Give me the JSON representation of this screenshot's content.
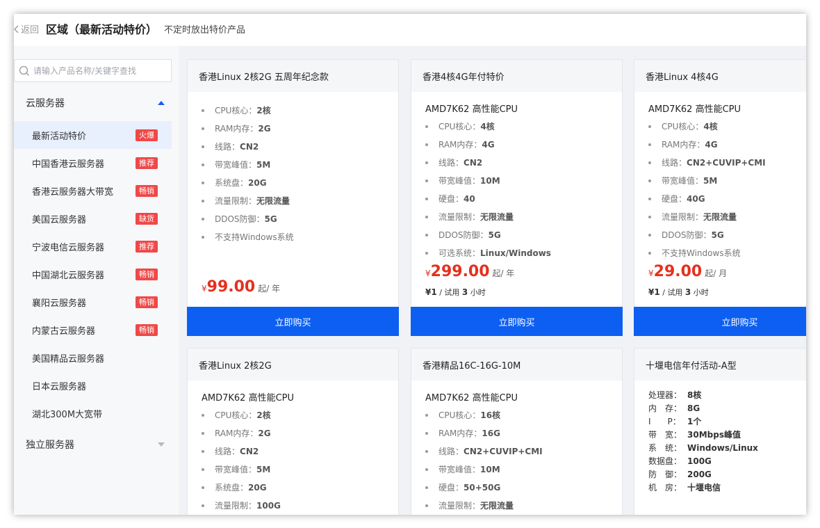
{
  "header": {
    "back_label": "返回",
    "title": "区域（最新活动特价）",
    "subtitle": "不定时放出特价产品"
  },
  "sidebar": {
    "search_placeholder": "请输入产品名称/关键字查找",
    "group_cloud": "云服务器",
    "group_dedicated": "独立服务器",
    "items": [
      {
        "label": "最新活动特价",
        "badge": "火爆"
      },
      {
        "label": "中国香港云服务器",
        "badge": "推荐"
      },
      {
        "label": "香港云服务器大带宽",
        "badge": "畅销"
      },
      {
        "label": "美国云服务器",
        "badge": "缺货"
      },
      {
        "label": "宁波电信云服务器",
        "badge": "推荐"
      },
      {
        "label": "中国湖北云服务器",
        "badge": "畅销"
      },
      {
        "label": "襄阳云服务器",
        "badge": "畅销"
      },
      {
        "label": "内蒙古云服务器",
        "badge": "畅销"
      },
      {
        "label": "美国精品云服务器",
        "badge": ""
      },
      {
        "label": "日本云服务器",
        "badge": ""
      },
      {
        "label": "湖北300M大宽带",
        "badge": ""
      }
    ]
  },
  "cards": [
    {
      "title": "香港Linux 2核2G 五周年纪念款",
      "specs": [
        {
          "k": "CPU核心：",
          "v": "2核"
        },
        {
          "k": "RAM内存：",
          "v": "2G"
        },
        {
          "k": "线路：",
          "v": "CN2"
        },
        {
          "k": "带宽峰值：",
          "v": "5M"
        },
        {
          "k": "系统盘：",
          "v": "20G"
        },
        {
          "k": "流量限制：",
          "v": "无限流量"
        },
        {
          "k": "DDOS防御：",
          "v": "5G"
        },
        {
          "k": "不支持Windows系统",
          "v": ""
        }
      ],
      "price_symbol": "¥",
      "price": "99.00",
      "price_unit": "起/ 年",
      "buy": "立即购买"
    },
    {
      "title": "香港4核4G年付特价",
      "cpu": "AMD7K62 高性能CPU",
      "specs": [
        {
          "k": "CPU核心：",
          "v": "4核"
        },
        {
          "k": "RAM内存：",
          "v": "4G"
        },
        {
          "k": "线路：",
          "v": "CN2"
        },
        {
          "k": "带宽峰值：",
          "v": "10M"
        },
        {
          "k": "硬盘：",
          "v": "40"
        },
        {
          "k": "流量限制：",
          "v": "无限流量"
        },
        {
          "k": "DDOS防御：",
          "v": "5G"
        },
        {
          "k": "可选系统：",
          "v": "Linux/Windows"
        }
      ],
      "price_symbol": "¥",
      "price": "299.00",
      "price_unit": "起/ 年",
      "trial_amt": "¥1",
      "trial_sep": " / 试用 ",
      "trial_hours": "3",
      "trial_suffix": " 小时",
      "buy": "立即购买"
    },
    {
      "title": "香港Linux 4核4G",
      "cpu": "AMD7K62 高性能CPU",
      "specs": [
        {
          "k": "CPU核心：",
          "v": "4核"
        },
        {
          "k": "RAM内存：",
          "v": "4G"
        },
        {
          "k": "线路：",
          "v": "CN2+CUVIP+CMI"
        },
        {
          "k": "带宽峰值：",
          "v": "5M"
        },
        {
          "k": "硬盘：",
          "v": "40G"
        },
        {
          "k": "流量限制：",
          "v": "无限流量"
        },
        {
          "k": "DDOS防御：",
          "v": "5G"
        },
        {
          "k": "不支持Windows系统",
          "v": ""
        }
      ],
      "price_symbol": "¥",
      "price": "29.00",
      "price_unit": "起/ 月",
      "trial_amt": "¥1",
      "trial_sep": " / 试用 ",
      "trial_hours": "3",
      "trial_suffix": " 小时",
      "buy": "立即购买"
    },
    {
      "title": "香港Linux 2核2G",
      "cpu": "AMD7K62 高性能CPU",
      "specs": [
        {
          "k": "CPU核心：",
          "v": "2核"
        },
        {
          "k": "RAM内存：",
          "v": "2G"
        },
        {
          "k": "线路：",
          "v": "CN2"
        },
        {
          "k": "带宽峰值：",
          "v": "5M"
        },
        {
          "k": "系统盘：",
          "v": "20G"
        },
        {
          "k": "流量限制：",
          "v": "100G"
        }
      ]
    },
    {
      "title": "香港精品16C-16G-10M",
      "cpu": "AMD7K62 高性能CPU",
      "specs": [
        {
          "k": "CPU核心：",
          "v": "16核"
        },
        {
          "k": "RAM内存：",
          "v": "16G"
        },
        {
          "k": "线路：",
          "v": "CN2+CUVIP+CMI"
        },
        {
          "k": "带宽峰值：",
          "v": "10M"
        },
        {
          "k": "硬盘：",
          "v": "50+50G"
        },
        {
          "k": "流量限制：",
          "v": "无限流量"
        }
      ]
    },
    {
      "title": "十堰电信年付活动-A型",
      "rows": [
        {
          "k": "处理器：",
          "v": "8核"
        },
        {
          "k": "内　存：",
          "v": "8G"
        },
        {
          "k": "I　　P：",
          "v": "1个"
        },
        {
          "k": "带　宽：",
          "v": "30Mbps峰值"
        },
        {
          "k": "系　统：",
          "v": "Windows/Linux"
        },
        {
          "k": "数据盘：",
          "v": "100G"
        },
        {
          "k": "防　御：",
          "v": "200G"
        },
        {
          "k": "机　房：",
          "v": "十堰电信"
        }
      ]
    }
  ]
}
